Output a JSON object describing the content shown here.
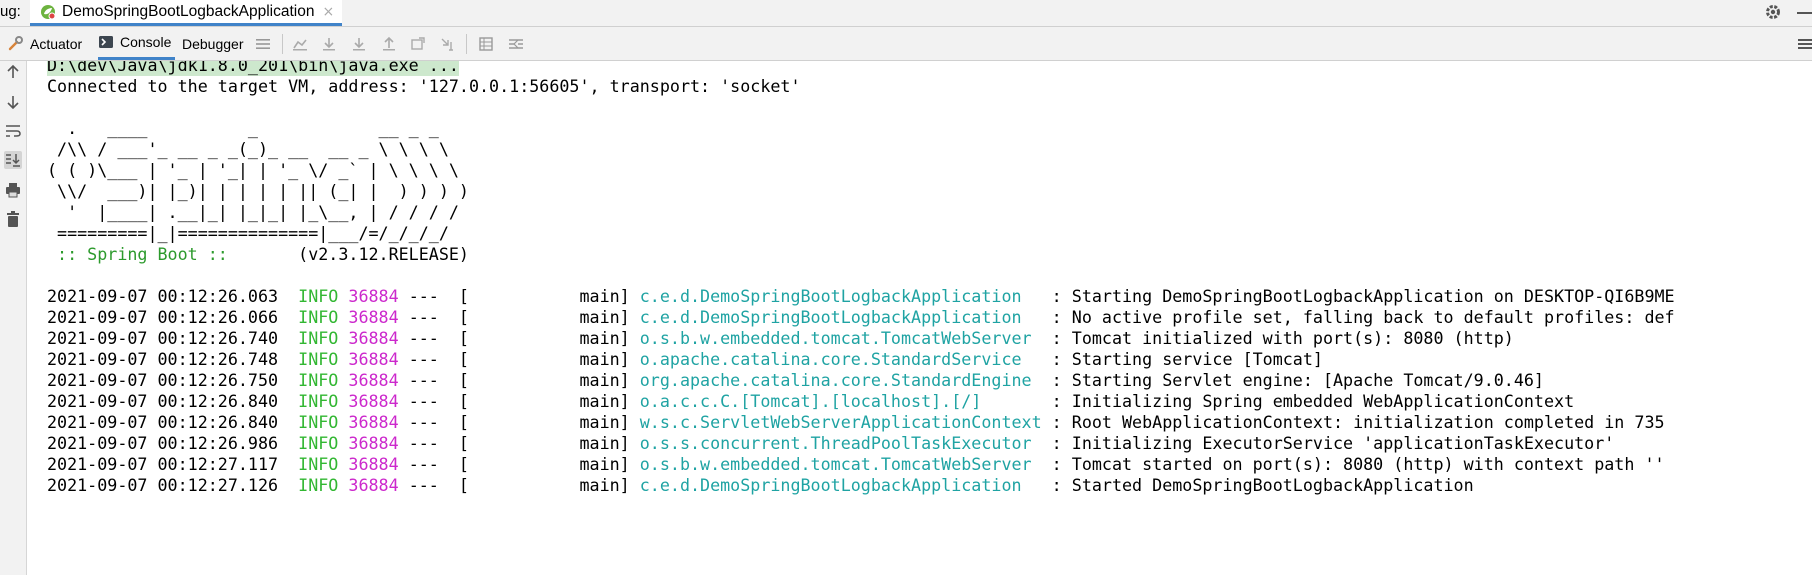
{
  "tabbar": {
    "prefix": "ug:",
    "run_tab_title": "DemoSpringBootLogbackApplication",
    "close_glyph": "×"
  },
  "toolbar": {
    "tabs": [
      {
        "label": "Actuator",
        "icon": "actuator-icon"
      },
      {
        "label": "Console",
        "icon": "console-icon"
      },
      {
        "label": "Debugger",
        "icon": ""
      }
    ]
  },
  "console": {
    "command": "D:\\dev\\Java\\jdk1.8.0_201\\bin\\java.exe ...",
    "connected": "Connected to the target VM, address: '127.0.0.1:56605', transport: 'socket'",
    "banner": [
      "  .   ____          _            __ _ _",
      " /\\\\ / ___'_ __ _ _(_)_ __  __ _ \\ \\ \\ \\",
      "( ( )\\___ | '_ | '_| | '_ \\/ _` | \\ \\ \\ \\",
      " \\\\/  ___)| |_)| | | | | || (_| |  ) ) ) )",
      "  '  |____| .__|_| |_|_| |_\\__, | / / / /",
      " =========|_|==============|___/=/_/_/_/"
    ],
    "spring_label": " :: Spring Boot :: ",
    "spring_version": "      (v2.3.12.RELEASE)",
    "logs": [
      {
        "ts": "2021-09-07 00:12:26.063",
        "level": "INFO",
        "pid": "36884",
        "thread": "---  [           main] ",
        "logger": "c.e.d.DemoSpringBootLogbackApplication  ",
        "msg": " : Starting DemoSpringBootLogbackApplication on DESKTOP-QI6B9ME"
      },
      {
        "ts": "2021-09-07 00:12:26.066",
        "level": "INFO",
        "pid": "36884",
        "thread": "---  [           main] ",
        "logger": "c.e.d.DemoSpringBootLogbackApplication  ",
        "msg": " : No active profile set, falling back to default profiles: def"
      },
      {
        "ts": "2021-09-07 00:12:26.740",
        "level": "INFO",
        "pid": "36884",
        "thread": "---  [           main] ",
        "logger": "o.s.b.w.embedded.tomcat.TomcatWebServer ",
        "msg": " : Tomcat initialized with port(s): 8080 (http)"
      },
      {
        "ts": "2021-09-07 00:12:26.748",
        "level": "INFO",
        "pid": "36884",
        "thread": "---  [           main] ",
        "logger": "o.apache.catalina.core.StandardService  ",
        "msg": " : Starting service [Tomcat]"
      },
      {
        "ts": "2021-09-07 00:12:26.750",
        "level": "INFO",
        "pid": "36884",
        "thread": "---  [           main] ",
        "logger": "org.apache.catalina.core.StandardEngine ",
        "msg": " : Starting Servlet engine: [Apache Tomcat/9.0.46]"
      },
      {
        "ts": "2021-09-07 00:12:26.840",
        "level": "INFO",
        "pid": "36884",
        "thread": "---  [           main] ",
        "logger": "o.a.c.c.C.[Tomcat].[localhost].[/]      ",
        "msg": " : Initializing Spring embedded WebApplicationContext"
      },
      {
        "ts": "2021-09-07 00:12:26.840",
        "level": "INFO",
        "pid": "36884",
        "thread": "---  [           main] ",
        "logger": "w.s.c.ServletWebServerApplicationContext",
        "msg": " : Root WebApplicationContext: initialization completed in 735"
      },
      {
        "ts": "2021-09-07 00:12:26.986",
        "level": "INFO",
        "pid": "36884",
        "thread": "---  [           main] ",
        "logger": "o.s.s.concurrent.ThreadPoolTaskExecutor ",
        "msg": " : Initializing ExecutorService 'applicationTaskExecutor'"
      },
      {
        "ts": "2021-09-07 00:12:27.117",
        "level": "INFO",
        "pid": "36884",
        "thread": "---  [           main] ",
        "logger": "o.s.b.w.embedded.tomcat.TomcatWebServer ",
        "msg": " : Tomcat started on port(s): 8080 (http) with context path ''"
      },
      {
        "ts": "2021-09-07 00:12:27.126",
        "level": "INFO",
        "pid": "36884",
        "thread": "---  [           main] ",
        "logger": "c.e.d.DemoSpringBootLogbackApplication  ",
        "msg": " : Started DemoSpringBootLogbackApplication"
      }
    ]
  },
  "colors": {
    "info": "#32b732",
    "pid": "#cc28cc",
    "logger": "#1fa3a3",
    "spring_label": "#2c9a2c",
    "command_highlight": "#cde8cd",
    "tab_underline": "#4083c9"
  }
}
